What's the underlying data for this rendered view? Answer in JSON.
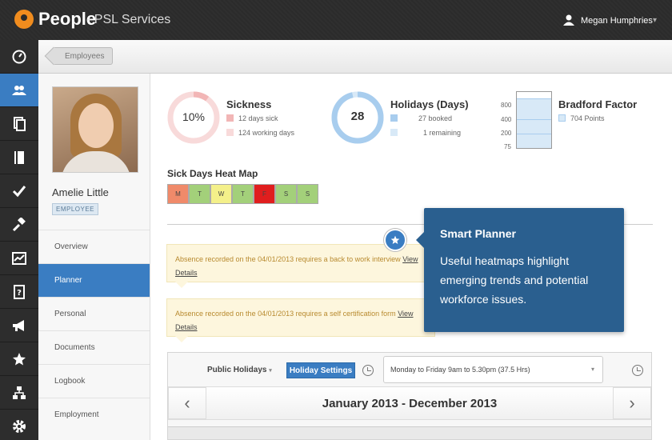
{
  "header": {
    "logo_text": "People",
    "app_subtitle": "- PSL Services",
    "user_name": "Megan Humphries"
  },
  "breadcrumb": {
    "label": "Employees"
  },
  "nav_icons": [
    "dashboard-icon",
    "people-icon",
    "documents-icon",
    "book-icon",
    "check-icon",
    "gavel-icon",
    "chart-icon",
    "help-icon",
    "megaphone-icon",
    "star-icon",
    "org-chart-icon",
    "gear-icon"
  ],
  "profile": {
    "name": "Amelie Little",
    "role_badge": "EMPLOYEE",
    "menu": [
      "Overview",
      "Planner",
      "Personal",
      "Documents",
      "Logbook",
      "Employment"
    ],
    "active_menu": "Planner"
  },
  "stats": {
    "sickness": {
      "title": "Sickness",
      "percent_label": "10%",
      "percent": 10,
      "line1": "12  days sick",
      "line2": "124  working days",
      "color1": "#f2b6b6",
      "color2": "#f8dada"
    },
    "holidays": {
      "title": "Holidays (Days)",
      "value_label": "28",
      "line1": "27  booked",
      "line2": "1  remaining",
      "color1": "#a8cdee",
      "color2": "#d8e9f7",
      "fraction_booked": 0.964
    },
    "bradford": {
      "title": "Bradford Factor",
      "points": "704 Points",
      "ticks": [
        "800",
        "400",
        "200",
        "75"
      ],
      "value": 704
    }
  },
  "heatmap": {
    "title": "Sick Days Heat Map",
    "days": [
      {
        "label": "M",
        "color": "#f08a6a"
      },
      {
        "label": "T",
        "color": "#a3d07a"
      },
      {
        "label": "W",
        "color": "#f4f08a"
      },
      {
        "label": "T",
        "color": "#a3d07a"
      },
      {
        "label": "F",
        "color": "#e01e1e"
      },
      {
        "label": "S",
        "color": "#a3d07a"
      },
      {
        "label": "S",
        "color": "#a3d07a"
      }
    ]
  },
  "alerts": [
    {
      "text": "Absence recorded on the 04/01/2013 requires a back to work interview",
      "link": "View Details"
    },
    {
      "text": "Absence recorded on the 04/01/2013 requires a self certification form",
      "link": "View Details"
    }
  ],
  "tooltip": {
    "title": "Smart Planner",
    "body": "Useful heatmaps highlight emerging trends and potential workforce issues."
  },
  "planner": {
    "public_holidays_label": "Public Holidays",
    "holiday_settings_label": "Holiday Settings",
    "working_hours": "Monday to Friday 9am to 5.30pm (37.5 Hrs)",
    "year_range": "January 2013 - December 2013",
    "prev_label": "‹",
    "next_label": "›"
  },
  "colors": {
    "accent": "#3a7dc2",
    "tooltip": "#2a5f8f",
    "topbar": "#2b2b2b"
  }
}
